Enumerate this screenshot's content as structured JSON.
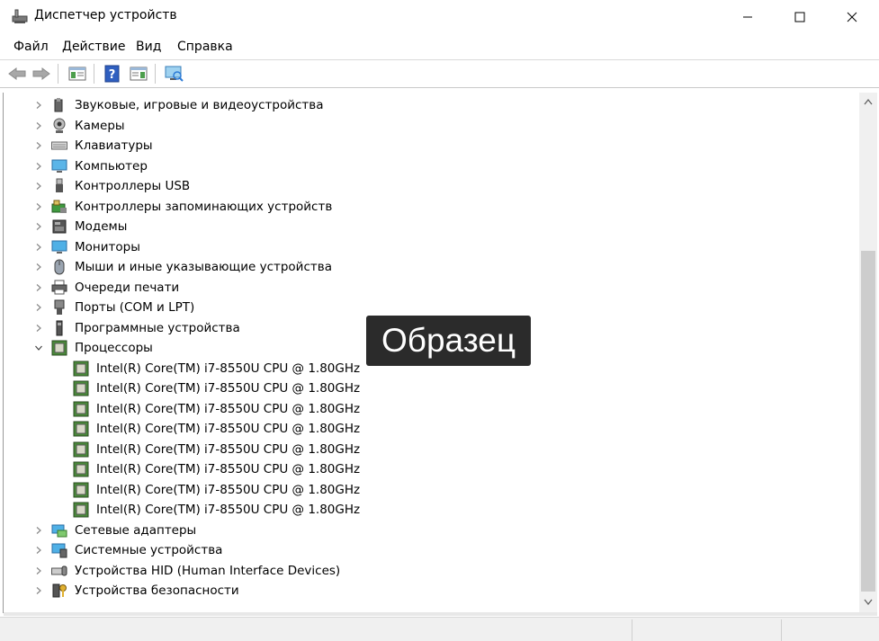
{
  "window": {
    "title": "Диспетчер устройств",
    "icon": "device-manager-icon",
    "buttons": [
      "minimize-icon",
      "maximize-icon",
      "close-icon"
    ]
  },
  "menu": {
    "items": [
      "Файл",
      "Действие",
      "Вид",
      "Справка"
    ]
  },
  "toolbar": {
    "icons": [
      "back-arrow-icon",
      "forward-arrow-icon",
      "properties-icon",
      "help-icon",
      "view-icon",
      "scan-hardware-icon"
    ]
  },
  "tree": {
    "categories": [
      {
        "label": "Звуковые, игровые и видеоустройства",
        "icon": "speaker-icon",
        "expanded": false
      },
      {
        "label": "Камеры",
        "icon": "camera-icon",
        "expanded": false
      },
      {
        "label": "Клавиатуры",
        "icon": "keyboard-icon",
        "expanded": false
      },
      {
        "label": "Компьютер",
        "icon": "computer-icon",
        "expanded": false
      },
      {
        "label": "Контроллеры USB",
        "icon": "usb-icon",
        "expanded": false
      },
      {
        "label": "Контроллеры запоминающих устройств",
        "icon": "storage-controller-icon",
        "expanded": false
      },
      {
        "label": "Модемы",
        "icon": "modem-icon",
        "expanded": false
      },
      {
        "label": "Мониторы",
        "icon": "monitor-icon",
        "expanded": false
      },
      {
        "label": "Мыши и иные указывающие устройства",
        "icon": "mouse-icon",
        "expanded": false
      },
      {
        "label": "Очереди печати",
        "icon": "printer-icon",
        "expanded": false
      },
      {
        "label": "Порты (COM и LPT)",
        "icon": "port-icon",
        "expanded": false
      },
      {
        "label": "Программные устройства",
        "icon": "software-device-icon",
        "expanded": false
      },
      {
        "label": "Процессоры",
        "icon": "cpu-icon",
        "expanded": true
      },
      {
        "label": "Сетевые адаптеры",
        "icon": "network-adapter-icon",
        "expanded": false
      },
      {
        "label": "Системные устройства",
        "icon": "system-device-icon",
        "expanded": false
      },
      {
        "label": "Устройства HID (Human Interface Devices)",
        "icon": "hid-icon",
        "expanded": false
      },
      {
        "label": "Устройства безопасности",
        "icon": "security-device-icon",
        "expanded": false
      }
    ],
    "processors": [
      "Intel(R) Core(TM) i7-8550U CPU @ 1.80GHz",
      "Intel(R) Core(TM) i7-8550U CPU @ 1.80GHz",
      "Intel(R) Core(TM) i7-8550U CPU @ 1.80GHz",
      "Intel(R) Core(TM) i7-8550U CPU @ 1.80GHz",
      "Intel(R) Core(TM) i7-8550U CPU @ 1.80GHz",
      "Intel(R) Core(TM) i7-8550U CPU @ 1.80GHz",
      "Intel(R) Core(TM) i7-8550U CPU @ 1.80GHz",
      "Intel(R) Core(TM) i7-8550U CPU @ 1.80GHz"
    ]
  },
  "watermark": "Образец",
  "colors": {
    "accent": "#2b7bd6",
    "watermark_bg": "#2b2b2b"
  }
}
